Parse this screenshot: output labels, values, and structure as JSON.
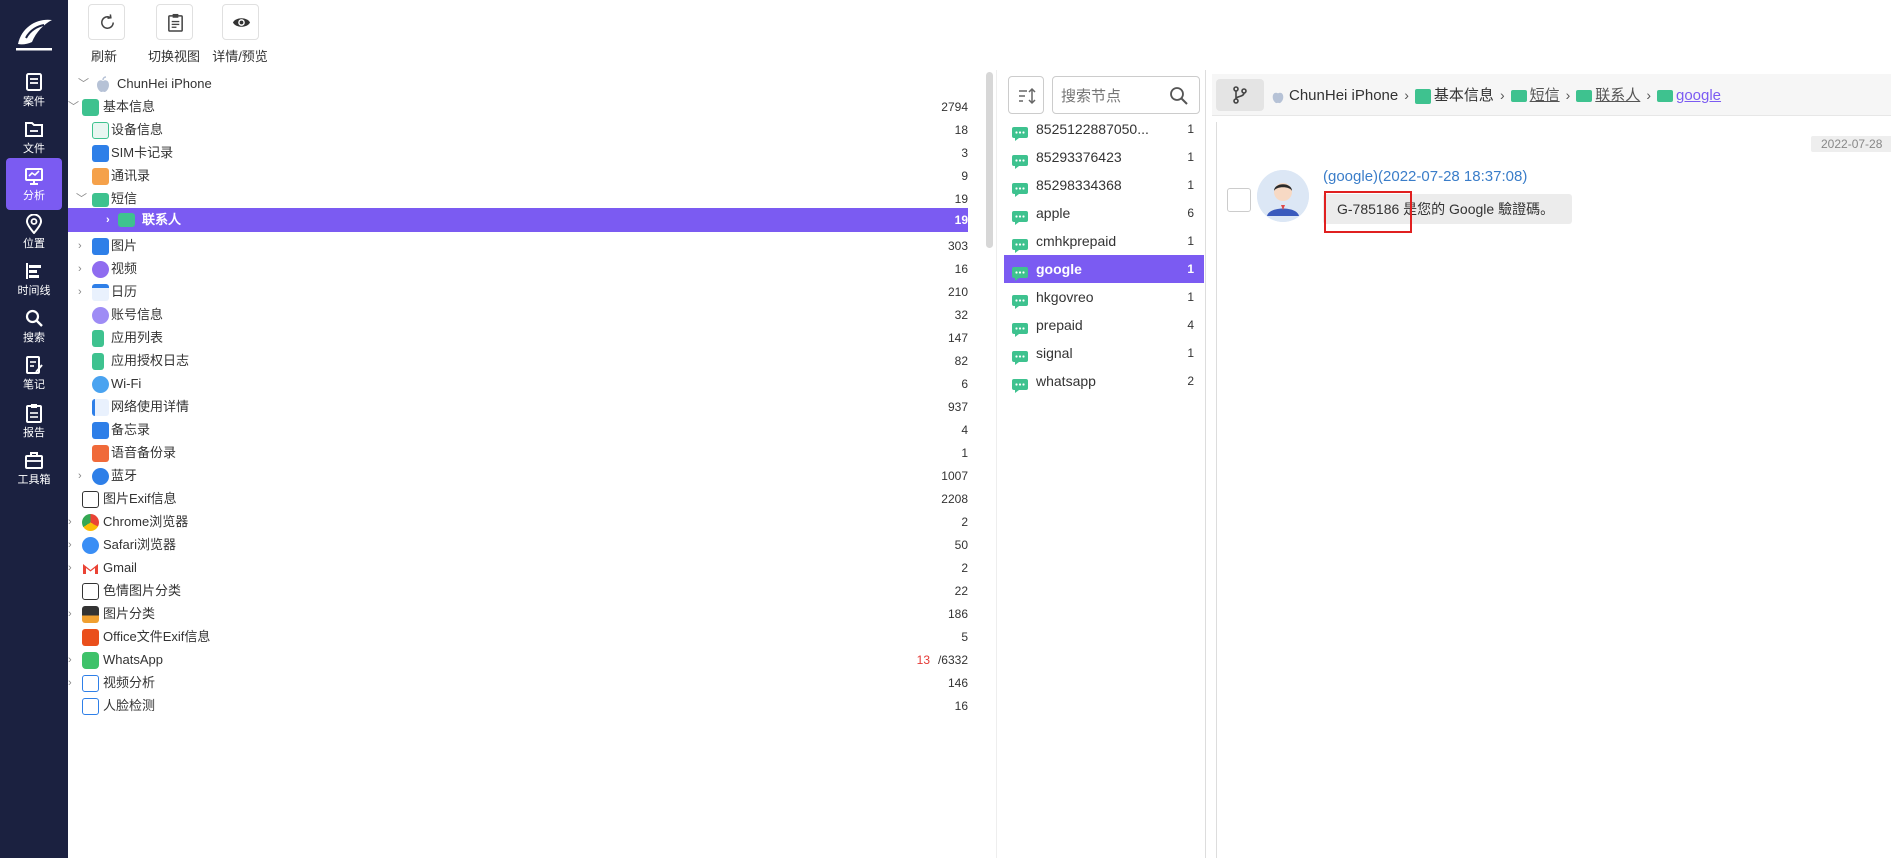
{
  "nav": {
    "items": [
      {
        "label": "案件",
        "icon": "case-icon"
      },
      {
        "label": "文件",
        "icon": "folder-icon"
      },
      {
        "label": "分析",
        "icon": "analysis-icon",
        "active": true
      },
      {
        "label": "位置",
        "icon": "location-icon"
      },
      {
        "label": "时间线",
        "icon": "timeline-icon"
      },
      {
        "label": "搜索",
        "icon": "search-icon"
      },
      {
        "label": "笔记",
        "icon": "note-icon"
      },
      {
        "label": "报告",
        "icon": "report-icon"
      },
      {
        "label": "工具箱",
        "icon": "toolbox-icon"
      }
    ]
  },
  "toolbar": {
    "refresh_label": "刷新",
    "switch_view_label": "切换视图",
    "preview_label": "详情/预览"
  },
  "tree": {
    "device": "ChunHei iPhone",
    "rows": [
      {
        "label": "基本信息",
        "count": "2794"
      },
      {
        "label": "设备信息",
        "count": "18"
      },
      {
        "label": "SIM卡记录",
        "count": "3"
      },
      {
        "label": "通讯录",
        "count": "9"
      },
      {
        "label": "短信",
        "count": "19"
      },
      {
        "label": "联系人",
        "count": "19"
      },
      {
        "label": "图片",
        "count": "303"
      },
      {
        "label": "视频",
        "count": "16"
      },
      {
        "label": "日历",
        "count": "210"
      },
      {
        "label": "账号信息",
        "count": "32"
      },
      {
        "label": "应用列表",
        "count": "147"
      },
      {
        "label": "应用授权日志",
        "count": "82"
      },
      {
        "label": "Wi-Fi",
        "count": "6"
      },
      {
        "label": "网络使用详情",
        "count": "937"
      },
      {
        "label": "备忘录",
        "count": "4"
      },
      {
        "label": "语音备份录",
        "count": "1"
      },
      {
        "label": "蓝牙",
        "count": "1007"
      },
      {
        "label": "图片Exif信息",
        "count": "2208"
      },
      {
        "label": "Chrome浏览器",
        "count": "2"
      },
      {
        "label": "Safari浏览器",
        "count": "50"
      },
      {
        "label": "Gmail",
        "count": "2"
      },
      {
        "label": "色情图片分类",
        "count": "22"
      },
      {
        "label": "图片分类",
        "count": "186"
      },
      {
        "label": "Office文件Exif信息",
        "count": "5"
      },
      {
        "label": "WhatsApp",
        "count_red": "13",
        "count": "/6332"
      },
      {
        "label": "视频分析",
        "count": "146"
      },
      {
        "label": "人脸检测",
        "count": "16"
      }
    ]
  },
  "middle": {
    "search_placeholder": "搜索节点",
    "rows": [
      {
        "label": "8525122887050...",
        "count": "1"
      },
      {
        "label": "85293376423",
        "count": "1"
      },
      {
        "label": "85298334368",
        "count": "1"
      },
      {
        "label": "apple",
        "count": "6"
      },
      {
        "label": "cmhkprepaid",
        "count": "1"
      },
      {
        "label": "google",
        "count": "1",
        "selected": true
      },
      {
        "label": "hkgovreo",
        "count": "1"
      },
      {
        "label": "prepaid",
        "count": "4"
      },
      {
        "label": "signal",
        "count": "1"
      },
      {
        "label": "whatsapp",
        "count": "2"
      }
    ]
  },
  "breadcrumb": {
    "items": [
      "ChunHei iPhone",
      "基本信息",
      "短信",
      "联系人",
      "google"
    ]
  },
  "message": {
    "date_badge": "2022-07-28",
    "sender": "(google)(2022-07-28 18:37:08)",
    "body": "G-785186 是您的 Google 驗證碼。"
  },
  "colors": {
    "accent": "#7b5bf2",
    "nav_bg": "#1b2140",
    "sms_green": "#3ec28f",
    "highlight": "#e02020"
  }
}
